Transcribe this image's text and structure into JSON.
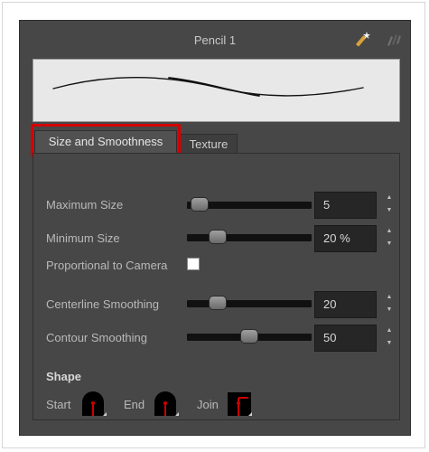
{
  "panel": {
    "title": "Pencil 1",
    "header_icons": [
      "magic-wand-icon",
      "brush-presets-icon"
    ]
  },
  "tabs": [
    {
      "label": "Size and Smoothness",
      "active": true
    },
    {
      "label": "Texture",
      "active": false
    }
  ],
  "controls": {
    "maximum_size": {
      "label": "Maximum Size",
      "value": "5",
      "slider_fraction": 0.03
    },
    "minimum_size": {
      "label": "Minimum Size",
      "value": "20 %",
      "slider_fraction": 0.2
    },
    "proportional_to_camera": {
      "label": "Proportional to Camera",
      "checked": false
    },
    "centerline_smoothing": {
      "label": "Centerline Smoothing",
      "value": "20",
      "slider_fraction": 0.2
    },
    "contour_smoothing": {
      "label": "Contour Smoothing",
      "value": "50",
      "slider_fraction": 0.5
    }
  },
  "shape": {
    "title": "Shape",
    "start_label": "Start",
    "end_label": "End",
    "join_label": "Join"
  },
  "colors": {
    "panel_bg": "#474747",
    "highlight": "#d40000",
    "stroke_preview": "#111111",
    "shape_marker": "#cc0000"
  }
}
